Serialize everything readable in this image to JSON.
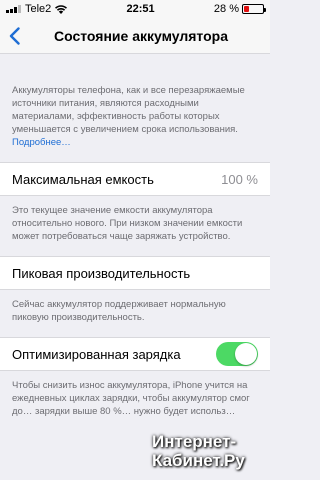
{
  "status_bar": {
    "carrier": "Tele2",
    "time": "22:51",
    "battery_text": "28 %",
    "battery_level": 0.28,
    "battery_color": "#e11111"
  },
  "nav": {
    "title": "Состояние аккумулятора"
  },
  "intro": {
    "text": "Аккумуляторы телефона, как и все перезаряжаемые источники питания, являются расходными материалами, эффективность работы которых уменьшается с увеличением срока использования.",
    "link": "Подробнее…"
  },
  "max_capacity": {
    "label": "Максимальная емкость",
    "value": "100 %",
    "note": "Это текущее значение емкости аккумулятора относительно нового. При низком значении емкости может потребоваться чаще заряжать устройство."
  },
  "peak_performance": {
    "label": "Пиковая производительность",
    "note": "Сейчас аккумулятор поддерживает нормальную пиковую производительность."
  },
  "optimized_charging": {
    "label": "Оптимизированная зарядка",
    "enabled": true,
    "toggle_color": "#4cd964",
    "note": "Чтобы снизить износ аккумулятора, iPhone учится на ежедневных циклах зарядки, чтобы аккумулятор смог до… зарядки выше 80 %… нужно будет использ…"
  },
  "watermark": {
    "text": "Интернет-Кабинет.Ру"
  }
}
